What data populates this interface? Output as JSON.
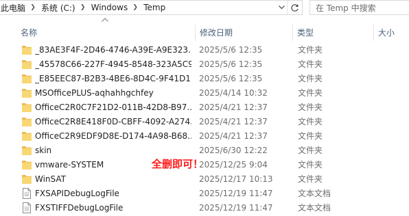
{
  "address": {
    "crumbs": [
      "此电脑",
      "系统 (C:)",
      "Windows",
      "Temp"
    ]
  },
  "search": {
    "placeholder": "在 Temp 中搜索"
  },
  "columns": {
    "name": "名称",
    "date": "修改日期",
    "type": "类型",
    "size": "大小"
  },
  "files": [
    {
      "name": "_83AE3F4F-2D46-4746-A39E-A9E323...",
      "date": "2025/5/6 12:35",
      "type": "文件夹",
      "icon": "folder-icon"
    },
    {
      "name": "_45578C66-227F-4945-8548-323A5C9...",
      "date": "2025/5/6 12:35",
      "type": "文件夹",
      "icon": "folder-icon"
    },
    {
      "name": "_E85EEC87-B2B3-4BE6-8D4C-9F41D1...",
      "date": "2025/5/6 12:35",
      "type": "文件夹",
      "icon": "folder-icon"
    },
    {
      "name": "MSOfficePLUS-aqhahhgchfey",
      "date": "2025/4/14 10:32",
      "type": "文件夹",
      "icon": "folder-icon"
    },
    {
      "name": "OfficeC2R0C7F21D2-011B-42D8-B97...",
      "date": "2025/4/21 12:37",
      "type": "文件夹",
      "icon": "folder-icon"
    },
    {
      "name": "OfficeC2R8E418F0D-CBFF-4092-A274...",
      "date": "2025/4/21 12:37",
      "type": "文件夹",
      "icon": "folder-icon"
    },
    {
      "name": "OfficeC2R9EDF9D8E-D174-4A98-B68...",
      "date": "2025/4/21 12:37",
      "type": "文件夹",
      "icon": "folder-icon"
    },
    {
      "name": "skin",
      "date": "2025/6/30 12:22",
      "type": "文件夹",
      "icon": "folder-icon"
    },
    {
      "name": "vmware-SYSTEM",
      "date": "2025/12/25 9:04",
      "type": "文件夹",
      "icon": "folder-icon"
    },
    {
      "name": "WinSAT",
      "date": "2025/12/17 10:13",
      "type": "文件夹",
      "icon": "folder-icon"
    },
    {
      "name": "FXSAPIDebugLogFile",
      "date": "2025/12/19 11:47",
      "type": "文本文档",
      "icon": "text-file-icon"
    },
    {
      "name": "FXSTIFFDebugLogFile",
      "date": "2025/12/19 11:47",
      "type": "文本文档",
      "icon": "text-file-icon"
    }
  ],
  "annotation": {
    "text": "全删即可！"
  },
  "colors": {
    "folder": "#f8d775",
    "folder_dark": "#e8b84a",
    "header_text": "#4c607a",
    "annotation": "#ff1a1a"
  }
}
